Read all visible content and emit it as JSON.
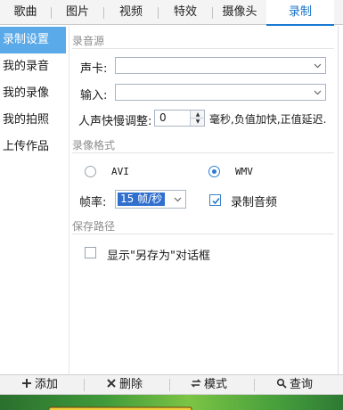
{
  "tabs": [
    {
      "label": "歌曲"
    },
    {
      "label": "图片"
    },
    {
      "label": "视频"
    },
    {
      "label": "特效"
    },
    {
      "label": "摄像头"
    },
    {
      "label": "录制"
    }
  ],
  "sidebar": {
    "items": [
      {
        "label": "录制设置"
      },
      {
        "label": "我的录音"
      },
      {
        "label": "我的录像"
      },
      {
        "label": "我的拍照"
      },
      {
        "label": "上传作品"
      }
    ]
  },
  "record_source": {
    "title": "录音源",
    "sound_card_label": "声卡:",
    "sound_card_value": "",
    "input_label": "输入:",
    "input_value": "",
    "delay_label": "人声快慢调整:",
    "delay_value": "0",
    "delay_hint": "毫秒,负值加快,正值延迟."
  },
  "video_format": {
    "title": "录像格式",
    "option_avi": "AVI",
    "option_wmv": "WMV",
    "selected": "WMV",
    "fps_label": "帧率:",
    "fps_value": "15 帧/秒",
    "record_audio_label": "录制音频",
    "record_audio_checked": true
  },
  "save_path": {
    "title": "保存路径",
    "show_save_as_label": "显示\"另存为\"对话框",
    "show_save_as_checked": false
  },
  "toolbar": {
    "add_label": "添加",
    "delete_label": "删除",
    "mode_label": "模式",
    "search_label": "查询"
  },
  "colors": {
    "accent": "#1a78d2",
    "sidebar_active": "#5aa9e8",
    "selection": "#2f6fce"
  }
}
